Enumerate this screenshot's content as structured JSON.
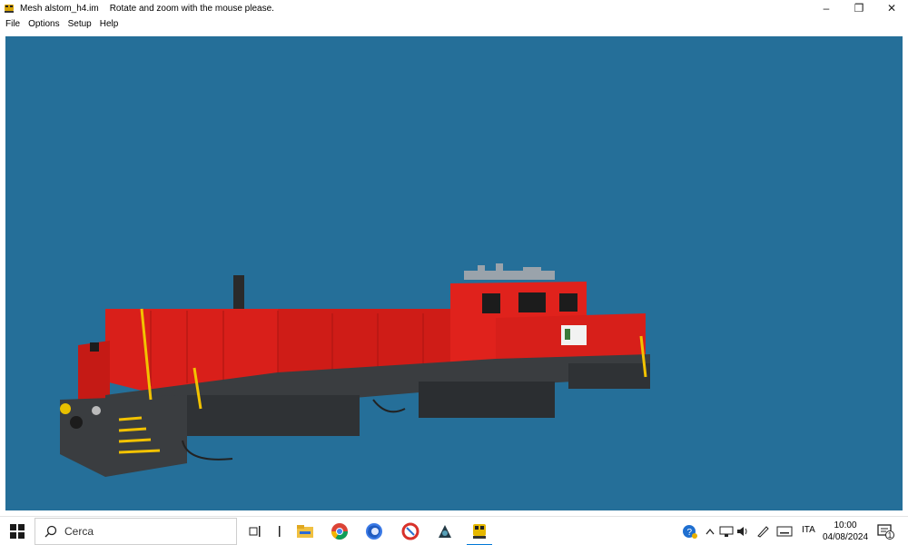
{
  "window": {
    "title": "Mesh alstom_h4.im",
    "hint": "Rotate and zoom with the mouse please.",
    "controls": {
      "minimize": "–",
      "restore": "❐",
      "close": "✕"
    }
  },
  "menu": [
    "File",
    "Options",
    "Setup",
    "Help"
  ],
  "viewport": {
    "background": "#256f99",
    "model": "locomotive"
  },
  "taskbar": {
    "search_placeholder": "Cerca",
    "apps": [
      "task-view-icon",
      "file-explorer-icon",
      "chrome-icon",
      "firefox-icon",
      "ccleaner-icon",
      "app-dark-icon",
      "mesh-viewer-icon"
    ],
    "language": "ITA",
    "time": "10:00",
    "date": "04/08/2024",
    "notification_count": "1"
  },
  "colors": {
    "accent": "#0078d7",
    "loco_red": "#e0221c",
    "frame_grey": "#3a3d40"
  }
}
